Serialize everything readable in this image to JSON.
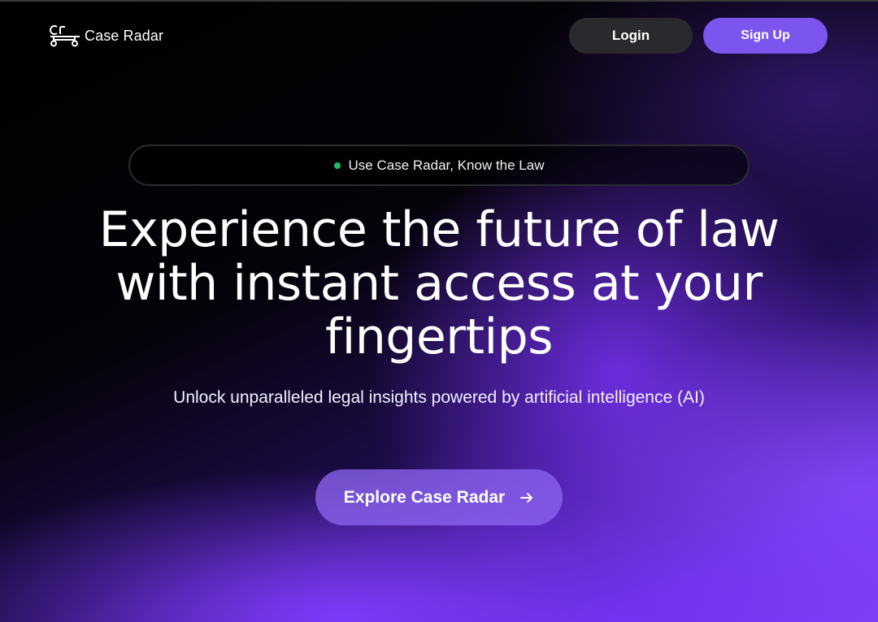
{
  "header": {
    "logo_text": "Case Radar",
    "login_label": "Login",
    "signup_label": "Sign Up"
  },
  "hero": {
    "badge_text": "Use Case Radar, Know the Law",
    "headline": "Experience the future of law with instant access at your fingertips",
    "subheadline": "Unlock unparalleled legal insights powered by artificial intelligence (AI)",
    "cta_label": "Explore Case Radar",
    "cta_icon": "arrow-right-icon"
  },
  "colors": {
    "accent": "#7c55ee",
    "login_bg": "#2a2a2e",
    "status_dot": "#1fb86a",
    "background_dark": "#000000",
    "background_purple": "#7b3cf5"
  }
}
